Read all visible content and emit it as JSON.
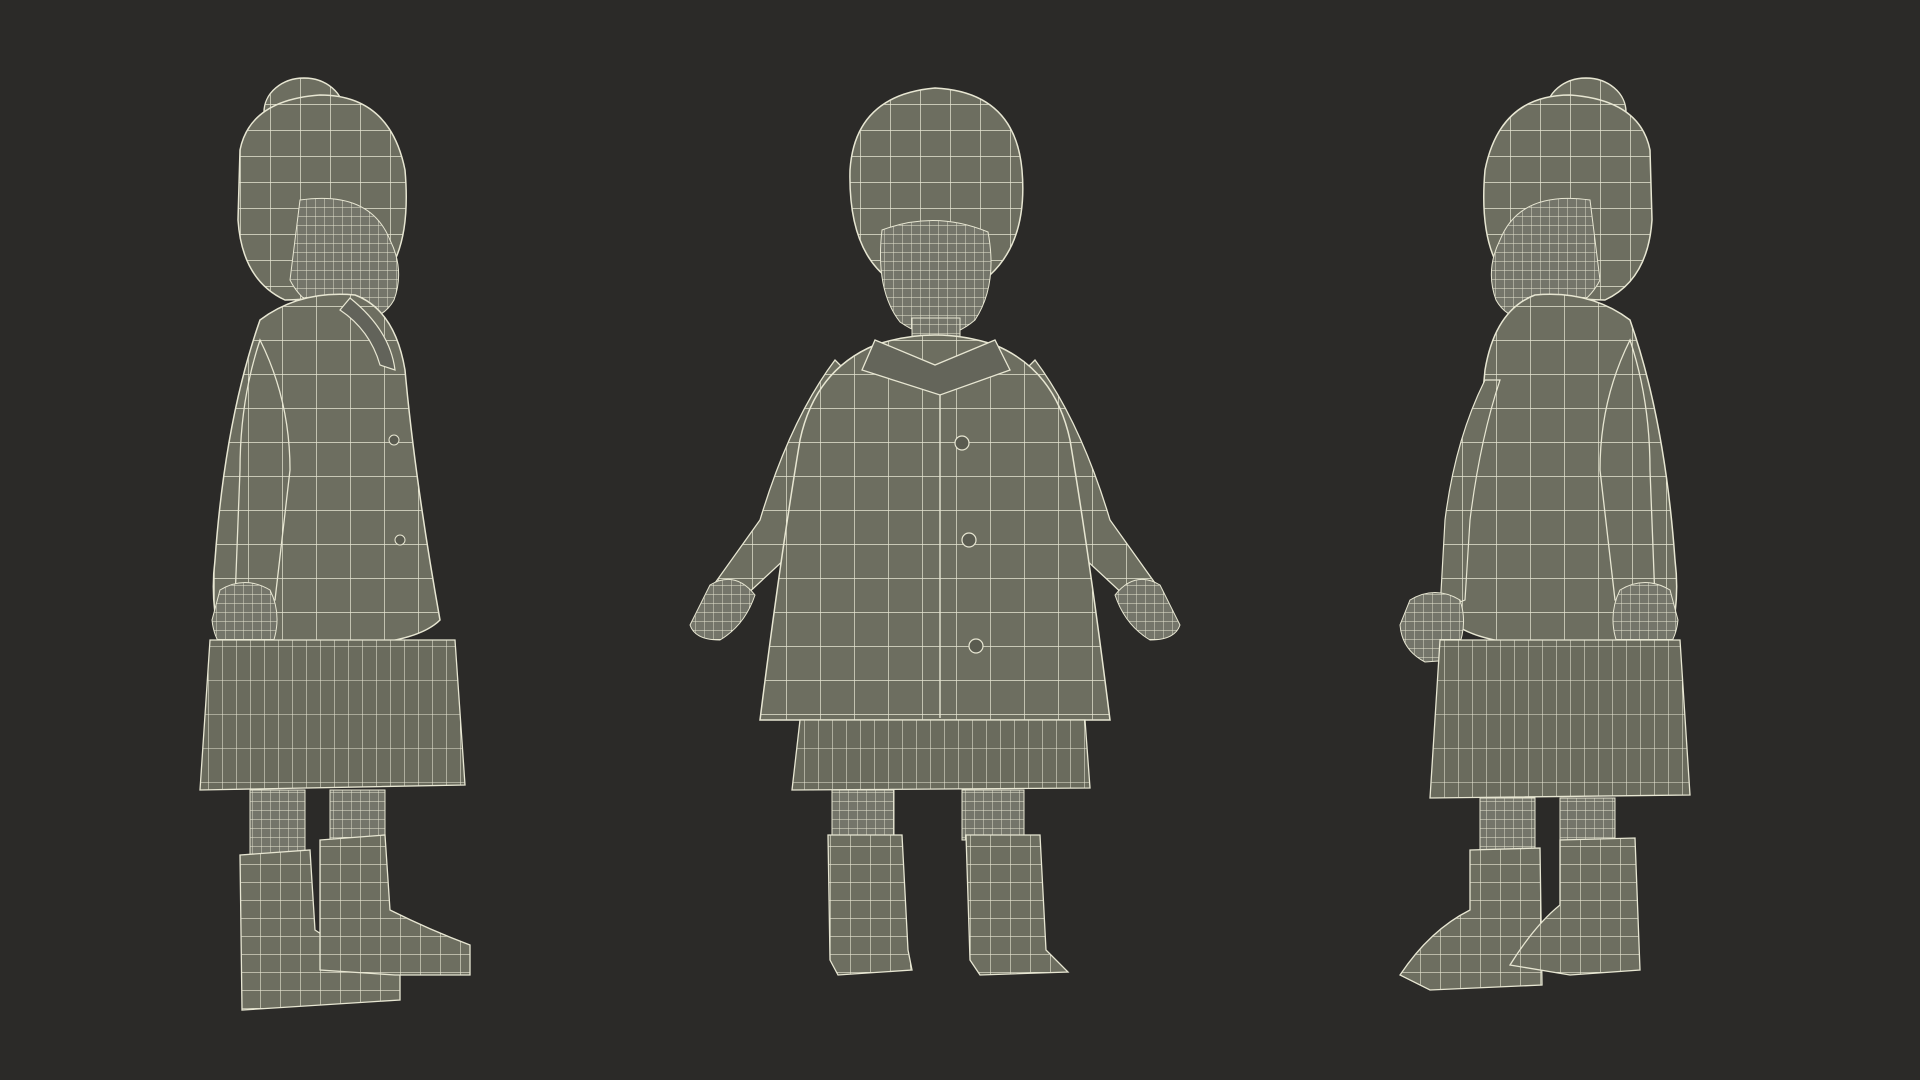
{
  "scene": {
    "background_color": "#2b2a28",
    "mesh_fill": "#6d6e60",
    "mesh_shade": "#5e5f53",
    "wire_color": "#e7e6d2",
    "views": [
      "side-left",
      "front",
      "side-right"
    ]
  }
}
